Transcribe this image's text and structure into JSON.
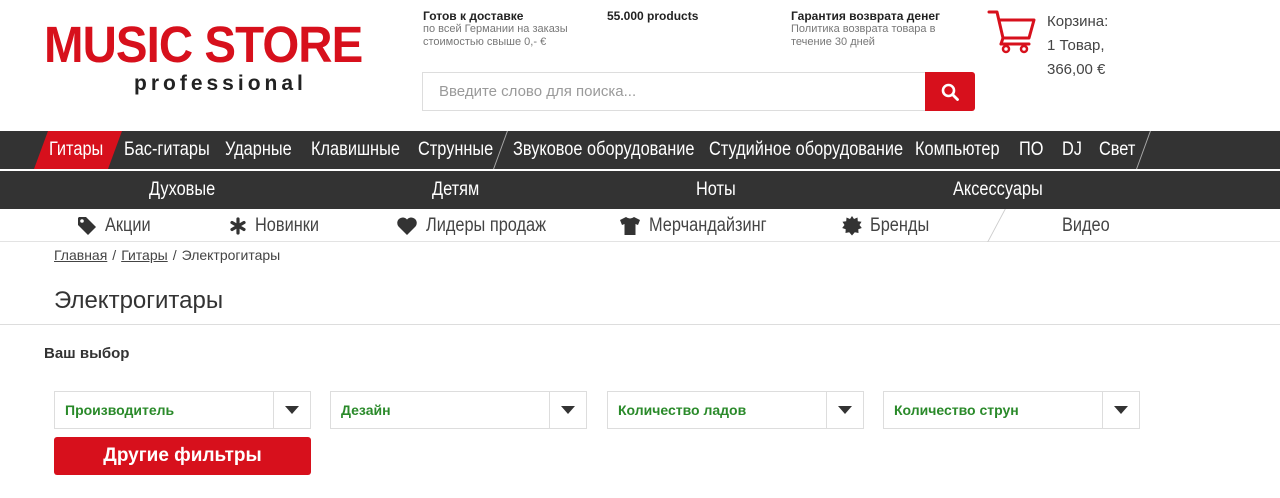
{
  "header": {
    "logo_main": "MUSIC STORE",
    "logo_sub": "professional",
    "usp": [
      {
        "title": "Готов к доставке",
        "sub": "по всей Германии на заказы стоимостью свыше 0,- €"
      },
      {
        "title": "55.000 products",
        "sub": ""
      },
      {
        "title": "Гарантия возврата денег",
        "sub": "Политика возврата товара в течение 30 дней"
      }
    ],
    "search_placeholder": "Введите слово для поиска...",
    "cart": {
      "label": "Корзина:",
      "items": "1 Товар,",
      "total": "366,00 €"
    }
  },
  "nav_main": [
    {
      "label": "Гитары",
      "active": true
    },
    {
      "label": "Бас-гитары"
    },
    {
      "label": "Ударные"
    },
    {
      "label": "Клавишные"
    },
    {
      "label": "Струнные"
    },
    {
      "label": "Звуковое оборудование"
    },
    {
      "label": "Студийное оборудование"
    },
    {
      "label": "Компьютер"
    },
    {
      "label": "ПО"
    },
    {
      "label": "DJ"
    },
    {
      "label": "Свет"
    }
  ],
  "nav_secondary": [
    {
      "label": "Духовые"
    },
    {
      "label": "Детям"
    },
    {
      "label": "Ноты"
    },
    {
      "label": "Аксессуары"
    }
  ],
  "nav_tertiary": [
    {
      "label": "Акции",
      "icon": "tag-icon"
    },
    {
      "label": "Новинки",
      "icon": "asterisk-icon"
    },
    {
      "label": "Лидеры продаж",
      "icon": "heart-icon"
    },
    {
      "label": "Мерчандайзинг",
      "icon": "tshirt-icon"
    },
    {
      "label": "Бренды",
      "icon": "badge-icon"
    },
    {
      "label": "Видео",
      "icon": ""
    }
  ],
  "breadcrumb": [
    {
      "label": "Главная",
      "link": true
    },
    {
      "label": "Гитары",
      "link": true
    },
    {
      "label": "Электрогитары",
      "link": false
    }
  ],
  "breadcrumb_separator": "/",
  "page_title": "Электрогитары",
  "filters": {
    "heading": "Ваш выбор",
    "items": [
      {
        "label": "Производитель"
      },
      {
        "label": "Дезайн"
      },
      {
        "label": "Количество ладов"
      },
      {
        "label": "Количество струн"
      }
    ],
    "more_button": "Другие фильтры"
  },
  "colors": {
    "brand_red": "#d7101c",
    "nav_dark": "#333333",
    "filter_green": "#2a8a2a"
  }
}
